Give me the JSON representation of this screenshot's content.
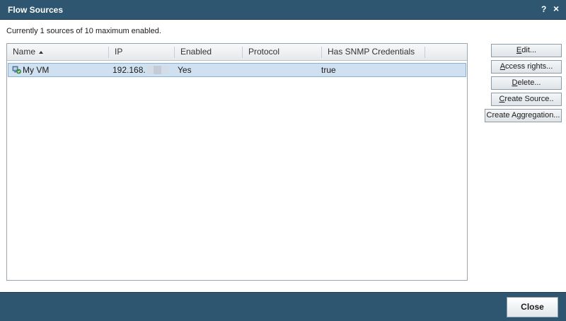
{
  "window": {
    "title": "Flow Sources",
    "help_label": "?",
    "close_label": "×"
  },
  "status": {
    "text": "Currently 1 sources of 10 maximum enabled."
  },
  "table": {
    "columns": [
      {
        "label": "Name",
        "sorted": "ascending"
      },
      {
        "label": "IP"
      },
      {
        "label": "Enabled"
      },
      {
        "label": "Protocol"
      },
      {
        "label": "Has SNMP Credentials"
      }
    ],
    "rows": [
      {
        "name": "My VM",
        "ip": "192.168.",
        "enabled": "Yes",
        "protocol": "",
        "has_snmp": "true",
        "icon": "vm-source-icon",
        "selected": true
      }
    ]
  },
  "buttons": {
    "edit": {
      "pre": "",
      "key": "E",
      "post": "dit..."
    },
    "access": {
      "pre": "",
      "key": "A",
      "post": "ccess rights..."
    },
    "delete": {
      "pre": "",
      "key": "D",
      "post": "elete..."
    },
    "create_source": {
      "pre": "",
      "key": "C",
      "post": "reate Source.."
    },
    "create_aggregation": {
      "pre": "Create A",
      "key": "g",
      "post": "gregation..."
    },
    "close": "Close"
  },
  "colors": {
    "titlebar": "#2e5670",
    "selected_row": "#cfe0f1"
  }
}
